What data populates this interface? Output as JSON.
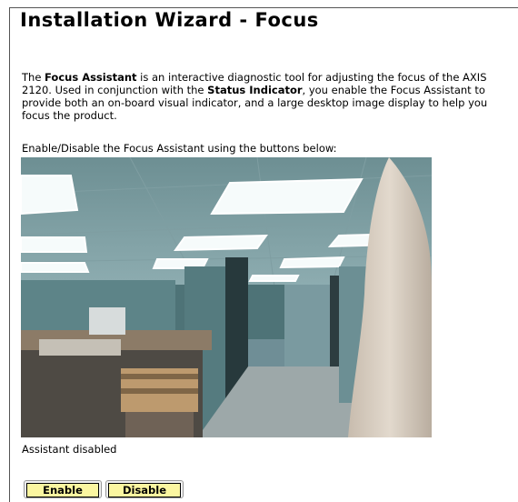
{
  "page": {
    "title": "Installation Wizard - Focus"
  },
  "intro": {
    "part1": "The ",
    "focus_assistant": "Focus Assistant",
    "part2": " is an interactive diagnostic tool for adjusting the focus of the AXIS 2120. Used in conjunction with the ",
    "status_indicator": "Status Indicator",
    "part3": ", you enable the Focus Assistant to provide both an on-board visual indicator, and a large desktop image display to help you focus the product."
  },
  "instruction": "Enable/Disable the Focus Assistant using the buttons below:",
  "camera_image": {
    "icon": "camera-snapshot"
  },
  "status": "Assistant disabled",
  "buttons": {
    "enable_label": "Enable",
    "disable_label": "Disable"
  },
  "colors": {
    "button_fill": "#fbf6a0",
    "border": "#555555"
  }
}
